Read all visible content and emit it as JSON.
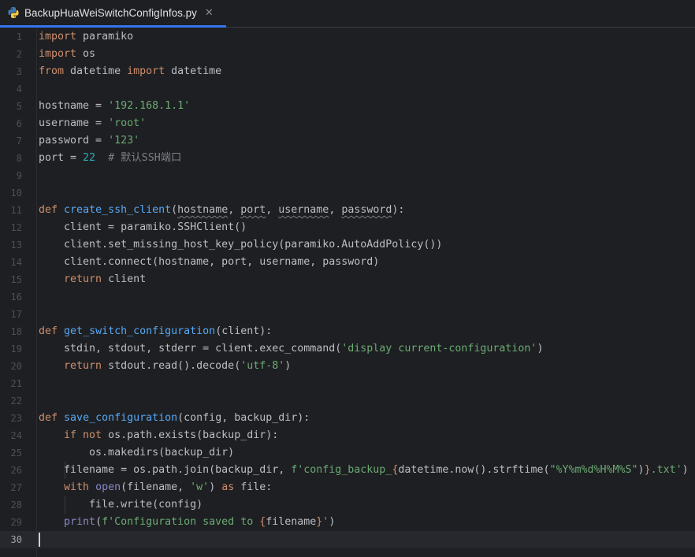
{
  "tab": {
    "filename": "BackupHuaWeiSwitchConfigInfos.py",
    "close_glyph": "✕",
    "icon": "python-file-icon"
  },
  "colors": {
    "background": "#1e1f22",
    "keyword": "#cf8e6d",
    "function": "#56a8f5",
    "string": "#6aab73",
    "number": "#2aacb8",
    "comment": "#7a7e85",
    "text": "#bcbec4",
    "tab_underline": "#3574f0"
  },
  "editor": {
    "current_line": 30,
    "lines": [
      {
        "n": "1",
        "tokens": [
          {
            "t": "kw",
            "v": "import"
          },
          {
            "t": "",
            "v": " paramiko"
          }
        ]
      },
      {
        "n": "2",
        "tokens": [
          {
            "t": "kw",
            "v": "import"
          },
          {
            "t": "",
            "v": " os"
          }
        ]
      },
      {
        "n": "3",
        "tokens": [
          {
            "t": "kw",
            "v": "from"
          },
          {
            "t": "",
            "v": " datetime "
          },
          {
            "t": "kw",
            "v": "import"
          },
          {
            "t": "",
            "v": " datetime"
          }
        ]
      },
      {
        "n": "4",
        "tokens": []
      },
      {
        "n": "5",
        "tokens": [
          {
            "t": "",
            "v": "hostname = "
          },
          {
            "t": "str",
            "v": "'192.168.1.1'"
          }
        ]
      },
      {
        "n": "6",
        "tokens": [
          {
            "t": "",
            "v": "username = "
          },
          {
            "t": "str",
            "v": "'root'"
          }
        ]
      },
      {
        "n": "7",
        "tokens": [
          {
            "t": "",
            "v": "password = "
          },
          {
            "t": "str",
            "v": "'123'"
          }
        ]
      },
      {
        "n": "8",
        "tokens": [
          {
            "t": "",
            "v": "port = "
          },
          {
            "t": "num",
            "v": "22"
          },
          {
            "t": "",
            "v": "  "
          },
          {
            "t": "cm",
            "v": "# 默认SSH端口"
          }
        ]
      },
      {
        "n": "9",
        "tokens": []
      },
      {
        "n": "10",
        "tokens": []
      },
      {
        "n": "11",
        "tokens": [
          {
            "t": "kw",
            "v": "def"
          },
          {
            "t": "",
            "v": " "
          },
          {
            "t": "fn",
            "v": "create_ssh_client"
          },
          {
            "t": "",
            "v": "("
          },
          {
            "t": "wavy",
            "v": "hostname"
          },
          {
            "t": "",
            "v": ", "
          },
          {
            "t": "wavy",
            "v": "port"
          },
          {
            "t": "",
            "v": ", "
          },
          {
            "t": "wavy",
            "v": "username"
          },
          {
            "t": "",
            "v": ", "
          },
          {
            "t": "wavy",
            "v": "password"
          },
          {
            "t": "",
            "v": "):"
          }
        ]
      },
      {
        "n": "12",
        "tokens": [
          {
            "t": "",
            "v": "    client = paramiko.SSHClient()"
          }
        ]
      },
      {
        "n": "13",
        "tokens": [
          {
            "t": "",
            "v": "    client.set_missing_host_key_policy(paramiko.AutoAddPolicy())"
          }
        ]
      },
      {
        "n": "14",
        "tokens": [
          {
            "t": "",
            "v": "    client.connect(hostname, port, username, password)"
          }
        ]
      },
      {
        "n": "15",
        "tokens": [
          {
            "t": "",
            "v": "    "
          },
          {
            "t": "kw",
            "v": "return"
          },
          {
            "t": "",
            "v": " client"
          }
        ]
      },
      {
        "n": "16",
        "tokens": []
      },
      {
        "n": "17",
        "tokens": []
      },
      {
        "n": "18",
        "tokens": [
          {
            "t": "kw",
            "v": "def"
          },
          {
            "t": "",
            "v": " "
          },
          {
            "t": "fn",
            "v": "get_switch_configuration"
          },
          {
            "t": "",
            "v": "(client):"
          }
        ]
      },
      {
        "n": "19",
        "tokens": [
          {
            "t": "",
            "v": "    stdin, stdout, stderr = client.exec_command("
          },
          {
            "t": "str",
            "v": "'display current-configuration'"
          },
          {
            "t": "",
            "v": ")"
          }
        ]
      },
      {
        "n": "20",
        "tokens": [
          {
            "t": "",
            "v": "    "
          },
          {
            "t": "kw",
            "v": "return"
          },
          {
            "t": "",
            "v": " stdout.read().decode("
          },
          {
            "t": "str",
            "v": "'utf-8'"
          },
          {
            "t": "",
            "v": ")"
          }
        ]
      },
      {
        "n": "21",
        "tokens": []
      },
      {
        "n": "22",
        "tokens": []
      },
      {
        "n": "23",
        "tokens": [
          {
            "t": "kw",
            "v": "def"
          },
          {
            "t": "",
            "v": " "
          },
          {
            "t": "fn",
            "v": "save_configuration"
          },
          {
            "t": "",
            "v": "(config, backup_dir):"
          }
        ]
      },
      {
        "n": "24",
        "tokens": [
          {
            "t": "",
            "v": "    "
          },
          {
            "t": "kw",
            "v": "if not"
          },
          {
            "t": "",
            "v": " os.path.exists(backup_dir):"
          }
        ]
      },
      {
        "n": "25",
        "tokens": [
          {
            "t": "",
            "v": "        os.makedirs(backup_dir)"
          }
        ]
      },
      {
        "n": "26",
        "tokens": [
          {
            "t": "",
            "v": "    filename = os.path.join(backup_dir, "
          },
          {
            "t": "str",
            "v": "f'config_backup_"
          },
          {
            "t": "kw",
            "v": "{"
          },
          {
            "t": "",
            "v": "datetime.now().strftime("
          },
          {
            "t": "str",
            "v": "\"%Y%m%d%H%M%S\""
          },
          {
            "t": "",
            "v": ")"
          },
          {
            "t": "kw",
            "v": "}"
          },
          {
            "t": "str",
            "v": ".txt'"
          },
          {
            "t": "",
            "v": ")"
          }
        ]
      },
      {
        "n": "27",
        "tokens": [
          {
            "t": "",
            "v": "    "
          },
          {
            "t": "kw",
            "v": "with"
          },
          {
            "t": "",
            "v": " "
          },
          {
            "t": "bi",
            "v": "open"
          },
          {
            "t": "",
            "v": "(filename, "
          },
          {
            "t": "str",
            "v": "'w'"
          },
          {
            "t": "",
            "v": ") "
          },
          {
            "t": "kw",
            "v": "as"
          },
          {
            "t": "",
            "v": " file:"
          }
        ]
      },
      {
        "n": "28",
        "tokens": [
          {
            "t": "",
            "v": "        file.write(config)"
          }
        ]
      },
      {
        "n": "29",
        "tokens": [
          {
            "t": "",
            "v": "    "
          },
          {
            "t": "bi",
            "v": "print"
          },
          {
            "t": "",
            "v": "("
          },
          {
            "t": "str",
            "v": "f'Configuration saved to "
          },
          {
            "t": "kw",
            "v": "{"
          },
          {
            "t": "",
            "v": "filename"
          },
          {
            "t": "kw",
            "v": "}"
          },
          {
            "t": "str",
            "v": "'"
          },
          {
            "t": "",
            "v": ")"
          }
        ]
      },
      {
        "n": "30",
        "tokens": []
      }
    ]
  }
}
